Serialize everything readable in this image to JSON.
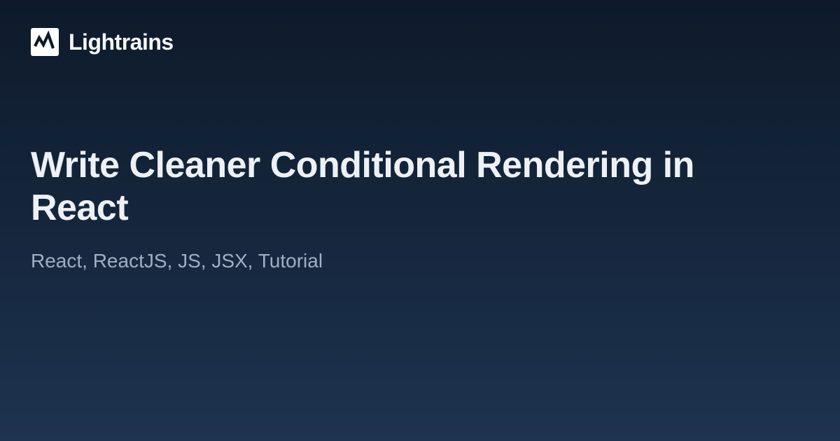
{
  "brand": {
    "name": "Lightrains"
  },
  "article": {
    "title": "Write Cleaner Conditional Rendering in React",
    "tags": "React, ReactJS, JS, JSX, Tutorial"
  }
}
